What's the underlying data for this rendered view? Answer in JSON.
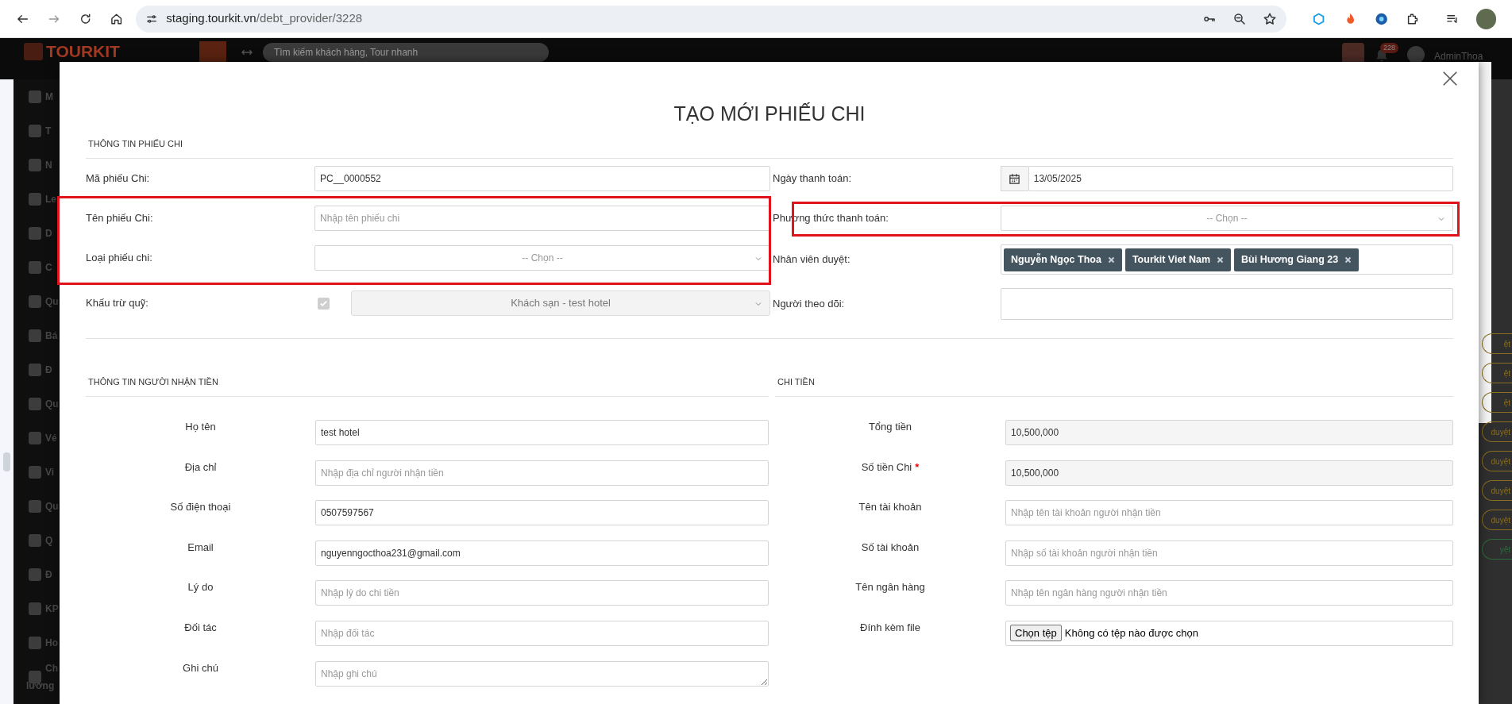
{
  "browser": {
    "url_host": "staging.tourkit.vn",
    "url_path": "/debt_provider/3228"
  },
  "app": {
    "logo": "TOURKIT",
    "search_placeholder": "Tìm kiếm khách hàng, Tour nhanh",
    "notification_count": "228",
    "user": "AdminThoa"
  },
  "sidebar": {
    "items": [
      {
        "lines": [
          "M"
        ]
      },
      {
        "lines": [
          "T"
        ]
      },
      {
        "lines": [
          "N"
        ]
      },
      {
        "lines": [
          "Le"
        ]
      },
      {
        "lines": [
          "D"
        ]
      },
      {
        "lines": [
          "C"
        ]
      },
      {
        "lines": [
          "Qu"
        ]
      },
      {
        "lines": [
          "Bá"
        ]
      },
      {
        "lines": [
          "Đ"
        ]
      },
      {
        "lines": [
          "Qu"
        ]
      },
      {
        "lines": [
          "Vé"
        ]
      },
      {
        "lines": [
          "Vi"
        ]
      },
      {
        "lines": [
          "Qu"
        ]
      },
      {
        "lines": [
          "Q"
        ]
      },
      {
        "lines": [
          "Đ"
        ]
      },
      {
        "lines": [
          "KP"
        ]
      },
      {
        "lines": [
          "Ho"
        ]
      },
      {
        "lines": [
          "Ch",
          "lương"
        ]
      }
    ]
  },
  "background_badges": [
    {
      "label": "ệt",
      "color": "#8a6d1e"
    },
    {
      "label": "ệt",
      "color": "#8a6d1e"
    },
    {
      "label": "ệt",
      "color": "#8a6d1e"
    },
    {
      "label": "duyệt",
      "color": "#8a6d1e"
    },
    {
      "label": "duyệt",
      "color": "#8a6d1e"
    },
    {
      "label": "duyệt",
      "color": "#8a6d1e"
    },
    {
      "label": "duyệt",
      "color": "#8a6d1e"
    },
    {
      "label": "yệt",
      "color": "#2e6b3e"
    }
  ],
  "modal": {
    "title": "TẠO MỚI PHIẾU CHI",
    "general": {
      "heading": "THÔNG TIN PHIẾU CHI",
      "left": [
        {
          "kind": "text",
          "label": "Mã phiếu Chi:",
          "value": "PC__0000552"
        },
        {
          "kind": "text",
          "label": "Tên phiếu Chi:",
          "placeholder": "Nhập tên phiếu chi",
          "highlighted": true
        },
        {
          "kind": "select",
          "label": "Loại phiếu chi:",
          "placeholder": "-- Chọn --",
          "highlighted": true
        },
        {
          "kind": "checkbox_select",
          "label": "Khấu trừ quỹ:",
          "checked": true,
          "disabled": true,
          "value": "Khách sạn - test hotel"
        }
      ],
      "right": [
        {
          "kind": "date",
          "label": "Ngày thanh toán:",
          "value": "13/05/2025"
        },
        {
          "kind": "select",
          "label": "Phương thức thanh toán:",
          "placeholder": "-- Chọn --",
          "highlighted": true
        },
        {
          "kind": "tags",
          "label": "Nhân viên duyệt:",
          "tags": [
            "Nguyễn Ngọc Thoa",
            "Tourkit Viet Nam",
            "Bùi Hương Giang 23"
          ]
        },
        {
          "kind": "tags_empty",
          "label": "Người theo dõi:"
        }
      ]
    },
    "recipient": {
      "heading": "THÔNG TIN NGƯỜI NHẬN TIỀN",
      "fields": [
        {
          "kind": "text",
          "label": "Họ tên",
          "value": "test hotel"
        },
        {
          "kind": "text",
          "label": "Địa chỉ",
          "placeholder": "Nhập địa chỉ người nhận tiền"
        },
        {
          "kind": "text",
          "label": "Số điện thoại",
          "value": "0507597567"
        },
        {
          "kind": "text",
          "label": "Email",
          "value": "nguyenngocthoa231@gmail.com"
        },
        {
          "kind": "text",
          "label": "Lý do",
          "placeholder": "Nhập lý do chi tiền"
        },
        {
          "kind": "text",
          "label": "Đối tác",
          "placeholder": "Nhập đối tác"
        },
        {
          "kind": "textarea",
          "label": "Ghi chú",
          "placeholder": "Nhập ghi chú"
        }
      ]
    },
    "payment": {
      "heading": "CHI TIỀN",
      "fields": [
        {
          "kind": "readonly",
          "label": "Tổng tiền",
          "value": "10,500,000"
        },
        {
          "kind": "readonly",
          "label": "Số tiền Chi",
          "required_mark": "*",
          "value": "10,500,000"
        },
        {
          "kind": "text",
          "label": "Tên tài khoản",
          "placeholder": "Nhập tên tài khoản người nhận tiền"
        },
        {
          "kind": "text",
          "label": "Số tài khoản",
          "placeholder": "Nhập số tài khoản người nhận tiền"
        },
        {
          "kind": "text",
          "label": "Tên ngân hàng",
          "placeholder": "Nhập tên ngân hàng người nhận tiền"
        },
        {
          "kind": "file",
          "label": "Đính kèm file",
          "button": "Chọn tệp",
          "status": "Không có tệp nào được chọn"
        }
      ]
    }
  }
}
